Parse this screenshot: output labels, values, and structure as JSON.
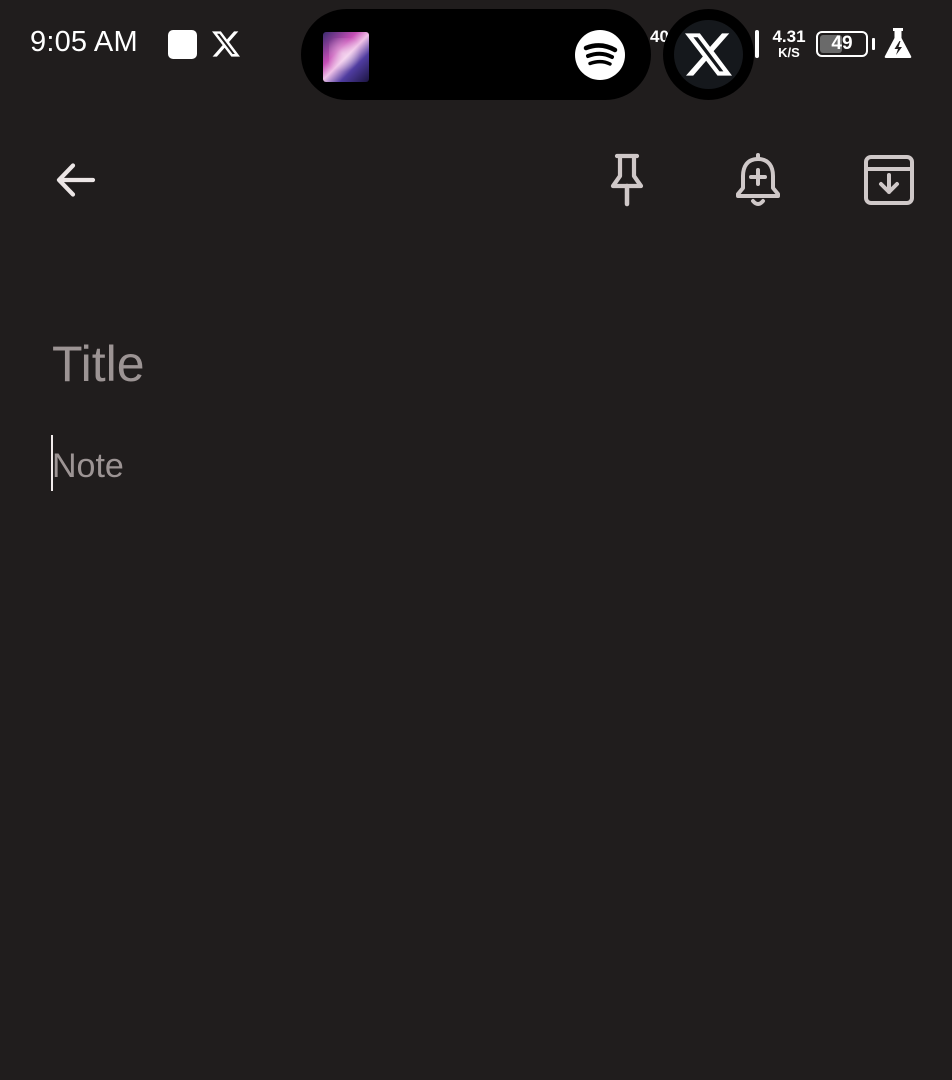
{
  "status_bar": {
    "time": "9:05 AM",
    "partial_text": "40",
    "net_speed_value": "4.31",
    "net_speed_unit": "K/S",
    "battery_percent": "49",
    "battery_level": 0.49,
    "icons": [
      "stop-square-icon",
      "x-logo-icon",
      "spotify-icon",
      "x-logo-icon",
      "signal-bar-icon",
      "battery-icon",
      "flask-icon"
    ]
  },
  "toolbar": {
    "icons": [
      "back-arrow-icon",
      "pin-icon",
      "add-reminder-icon",
      "archive-icon"
    ]
  },
  "editor": {
    "title_placeholder": "Title",
    "note_placeholder": "Note",
    "title_value": "",
    "note_value": ""
  },
  "colors": {
    "background": "#201d1d",
    "icon": "#cfc8c8",
    "placeholder": "#9c9494",
    "text": "#ffffff"
  }
}
